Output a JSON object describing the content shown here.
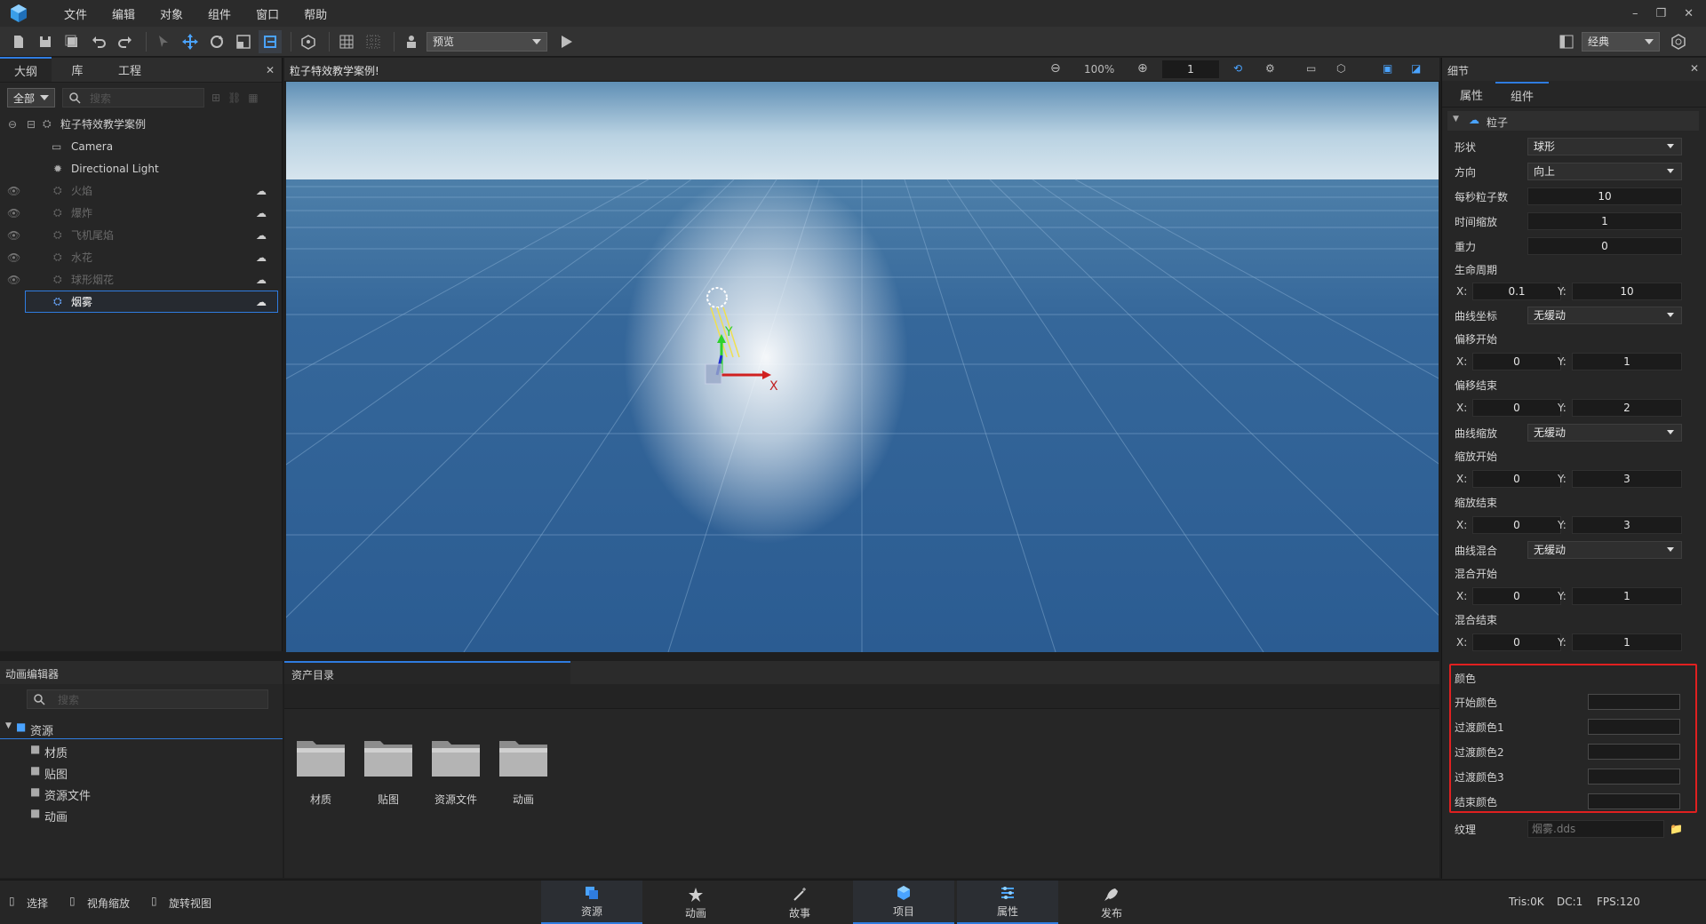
{
  "menu": {
    "items": [
      "文件",
      "编辑",
      "对象",
      "组件",
      "窗口",
      "帮助"
    ]
  },
  "toolbar": {
    "preview_select": "预览",
    "layout_select": "经典"
  },
  "outline": {
    "tabs": [
      "大纲",
      "库",
      "工程"
    ],
    "filter": "全部",
    "search_placeholder": "搜索",
    "root": "粒子特效教学案例",
    "items": [
      {
        "label": "Camera"
      },
      {
        "label": "Directional Light"
      },
      {
        "label": "火焰"
      },
      {
        "label": "爆炸"
      },
      {
        "label": "飞机尾焰"
      },
      {
        "label": "水花"
      },
      {
        "label": "球形烟花"
      },
      {
        "label": "烟雾"
      }
    ]
  },
  "viewport": {
    "title": "粒子特效教学案例!",
    "zoom": "100%",
    "frame": "1",
    "axis_x": "X",
    "axis_y": "Y"
  },
  "details": {
    "title": "细节",
    "tabs": [
      "属性",
      "组件"
    ],
    "section": "粒子",
    "shape_label": "形状",
    "shape_value": "球形",
    "direction_label": "方向",
    "direction_value": "向上",
    "rate_label": "每秒粒子数",
    "rate_value": "10",
    "timescale_label": "时间缩放",
    "timescale_value": "1",
    "gravity_label": "重力",
    "gravity_value": "0",
    "lifetime_label": "生命周期",
    "lifetime_x": "0.1",
    "lifetime_y": "10",
    "curve_coord_label": "曲线坐标",
    "curve_coord_value": "无缓动",
    "offset_start_label": "偏移开始",
    "offset_start_x": "0",
    "offset_start_y": "1",
    "offset_end_label": "偏移结束",
    "offset_end_x": "0",
    "offset_end_y": "2",
    "curve_scale_label": "曲线缩放",
    "curve_scale_value": "无缓动",
    "scale_start_label": "缩放开始",
    "scale_start_x": "0",
    "scale_start_y": "3",
    "scale_end_label": "缩放结束",
    "scale_end_x": "0",
    "scale_end_y": "3",
    "curve_blend_label": "曲线混合",
    "curve_blend_value": "无缓动",
    "blend_start_label": "混合开始",
    "blend_start_x": "0",
    "blend_start_y": "1",
    "blend_end_label": "混合结束",
    "blend_end_x": "0",
    "blend_end_y": "1",
    "x_label": "X:",
    "y_label": "Y:",
    "color_section": "颜色",
    "start_color_label": "开始颜色",
    "trans1_label": "过渡颜色1",
    "trans2_label": "过渡颜色2",
    "trans3_label": "过渡颜色3",
    "end_color_label": "结束颜色",
    "texture_label": "纹理",
    "texture_value": "烟雾.dds"
  },
  "anim_editor": {
    "title": "动画编辑器",
    "search_placeholder": "搜索",
    "root": "资源",
    "items": [
      "材质",
      "贴图",
      "资源文件",
      "动画"
    ]
  },
  "asset_dir": {
    "title": "资产目录",
    "folders": [
      "材质",
      "贴图",
      "资源文件",
      "动画"
    ]
  },
  "status": {
    "select": "选择",
    "zoom_view": "视角缩放",
    "rotate_view": "旋转视图",
    "nav": [
      "资源",
      "动画",
      "故事",
      "项目",
      "属性",
      "发布"
    ],
    "tris": "Tris:0K",
    "dc": "DC:1",
    "fps": "FPS:120"
  },
  "colors": {
    "accent": "#2f7ce0",
    "highlight_box": "#e02020",
    "sky": "#c8dde8",
    "ground": "#2d5f95"
  }
}
